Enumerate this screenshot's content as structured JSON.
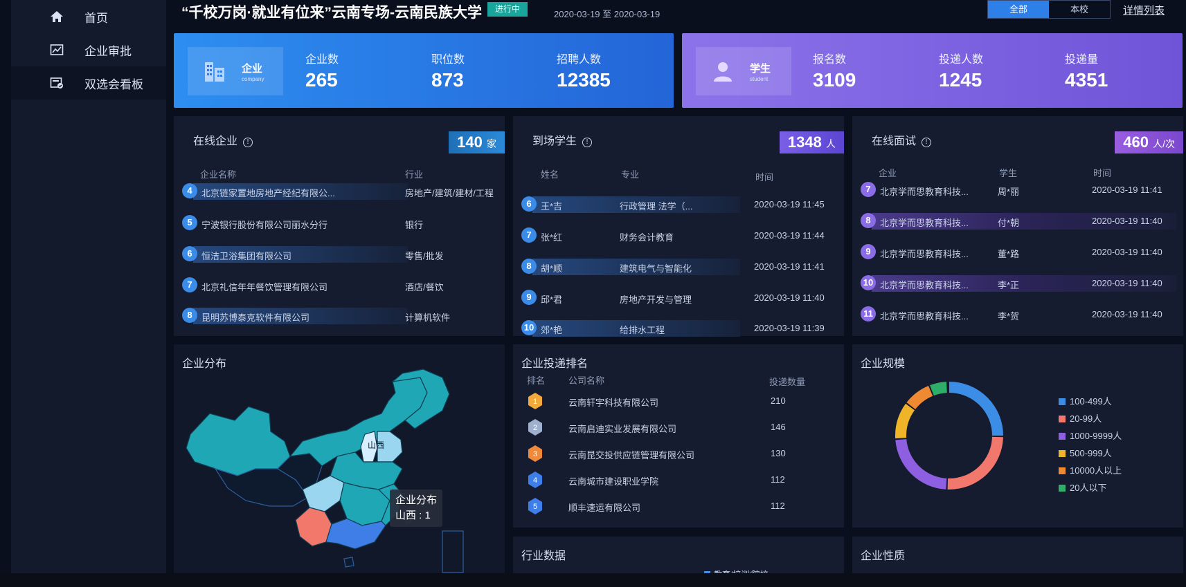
{
  "sidebar": {
    "items": [
      {
        "label": "首页",
        "icon": "home-icon"
      },
      {
        "label": "企业审批",
        "icon": "chart-icon"
      },
      {
        "label": "双选会看板",
        "icon": "board-icon"
      }
    ]
  },
  "header": {
    "title": "“千校万岗·就业有位来”云南专场-云南民族大学",
    "status": "进行中",
    "date_range": "2020-03-19 至 2020-03-19",
    "toggle": [
      "全部",
      "本校"
    ],
    "detail_link": "详情列表"
  },
  "company_banner": {
    "label_cn": "企业",
    "label_en": "company",
    "stats": [
      {
        "label": "企业数",
        "value": "265"
      },
      {
        "label": "职位数",
        "value": "873"
      },
      {
        "label": "招聘人数",
        "value": "12385"
      }
    ]
  },
  "student_banner": {
    "label_cn": "学生",
    "label_en": "student",
    "stats": [
      {
        "label": "报名数",
        "value": "3109"
      },
      {
        "label": "投递人数",
        "value": "1245"
      },
      {
        "label": "投递量",
        "value": "4351"
      }
    ]
  },
  "online_companies": {
    "title": "在线企业",
    "count": "140",
    "unit": "家",
    "headers": [
      "企业名称",
      "行业"
    ],
    "rows": [
      {
        "n": "4",
        "name": "北京链家置地房地产经纪有限公...",
        "industry": "房地产/建筑/建材/工程"
      },
      {
        "n": "5",
        "name": "宁波银行股份有限公司丽水分行",
        "industry": "银行"
      },
      {
        "n": "6",
        "name": "恒洁卫浴集团有限公司",
        "industry": "零售/批发"
      },
      {
        "n": "7",
        "name": "北京礼信年年餐饮管理有限公司",
        "industry": "酒店/餐饮"
      },
      {
        "n": "8",
        "name": "昆明苏博泰克软件有限公司",
        "industry": "计算机软件"
      }
    ]
  },
  "arrived_students": {
    "title": "到场学生",
    "count": "1348",
    "unit": "人",
    "headers": [
      "姓名",
      "专业",
      "时间"
    ],
    "rows": [
      {
        "n": "6",
        "name": "王*吉",
        "major": "行政管理 法学（...",
        "time": "2020-03-19 11:45"
      },
      {
        "n": "7",
        "name": "张*红",
        "major": "财务会计教育",
        "time": "2020-03-19 11:44"
      },
      {
        "n": "8",
        "name": "胡*顺",
        "major": "建筑电气与智能化",
        "time": "2020-03-19 11:41"
      },
      {
        "n": "9",
        "name": "邱*君",
        "major": "房地产开发与管理",
        "time": "2020-03-19 11:40"
      },
      {
        "n": "10",
        "name": "郊*艳",
        "major": "给排水工程",
        "time": "2020-03-19 11:39"
      }
    ]
  },
  "online_interviews": {
    "title": "在线面试",
    "count": "460",
    "unit": "人/次",
    "headers": [
      "企业",
      "学生",
      "时间"
    ],
    "rows": [
      {
        "n": "7",
        "company": "北京学而思教育科技...",
        "student": "周*丽",
        "time": "2020-03-19 11:41"
      },
      {
        "n": "8",
        "company": "北京学而思教育科技...",
        "student": "付*朝",
        "time": "2020-03-19 11:40"
      },
      {
        "n": "9",
        "company": "北京学而思教育科技...",
        "student": "董*路",
        "time": "2020-03-19 11:40"
      },
      {
        "n": "10",
        "company": "北京学而思教育科技...",
        "student": "李*正",
        "time": "2020-03-19 11:40"
      },
      {
        "n": "11",
        "company": "北京学而思教育科技...",
        "student": "李*贺",
        "time": "2020-03-19 11:40"
      }
    ]
  },
  "company_distribution": {
    "title": "企业分布",
    "map_label": "山西",
    "tooltip_title": "企业分布",
    "tooltip_value": "山西 : 1"
  },
  "delivery_ranking": {
    "title": "企业投递排名",
    "headers": [
      "排名",
      "公司名称",
      "投递数量"
    ],
    "rows": [
      {
        "rank": "1",
        "name": "云南轩宇科技有限公司",
        "count": "210"
      },
      {
        "rank": "2",
        "name": "云南启迪实业发展有限公司",
        "count": "146"
      },
      {
        "rank": "3",
        "name": "云南昆交投供应链管理有限公司",
        "count": "130"
      },
      {
        "rank": "4",
        "name": "云南城市建设职业学院",
        "count": "112"
      },
      {
        "rank": "5",
        "name": "顺丰速运有限公司",
        "count": "112"
      }
    ]
  },
  "company_scale": {
    "title": "企业规模",
    "legend": [
      {
        "label": "100-499人",
        "color": "#3b8de6"
      },
      {
        "label": "20-99人",
        "color": "#f2776c"
      },
      {
        "label": "1000-9999人",
        "color": "#8e5fe0"
      },
      {
        "label": "500-999人",
        "color": "#f0b429"
      },
      {
        "label": "10000人以上",
        "color": "#ef8a33"
      },
      {
        "label": "20人以下",
        "color": "#2fae69"
      }
    ]
  },
  "industry_data": {
    "title": "行业数据",
    "legend_label": "教育/培训/院校"
  },
  "company_nature": {
    "title": "企业性质"
  }
}
